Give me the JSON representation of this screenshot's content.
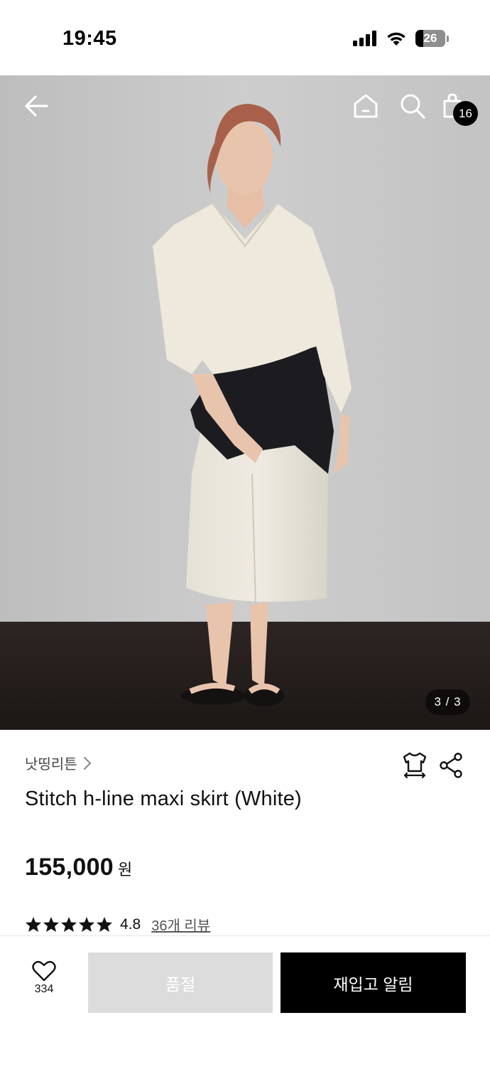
{
  "status_bar": {
    "time": "19:45",
    "battery_level": "26",
    "battery_fraction": 0.26,
    "icons": [
      "cellular-signal-icon",
      "wifi-icon",
      "battery-icon"
    ]
  },
  "top_nav": {
    "icons": [
      "back-arrow-icon",
      "home-icon",
      "search-icon",
      "shopping-bag-icon"
    ],
    "cart_count": "16"
  },
  "gallery": {
    "page_indicator": "3 / 3",
    "current": 3,
    "total": 3
  },
  "product": {
    "brand": "낫띵리튼",
    "brand_chevron": "›",
    "title": "Stitch h-line maxi skirt (White)",
    "price": "155,000",
    "currency": "원",
    "rating": "4.8",
    "stars_filled": 5,
    "review_link": "36개 리뷰",
    "action_icons": [
      "size-guide-shirt-icon",
      "share-icon"
    ]
  },
  "bottom_bar": {
    "like_count": "334",
    "soldout_label": "품절",
    "restock_label": "재입고 알림"
  },
  "colors": {
    "accent": "#000000",
    "soldout_bg": "#dcdcdc",
    "badge_bg": "#000000"
  }
}
